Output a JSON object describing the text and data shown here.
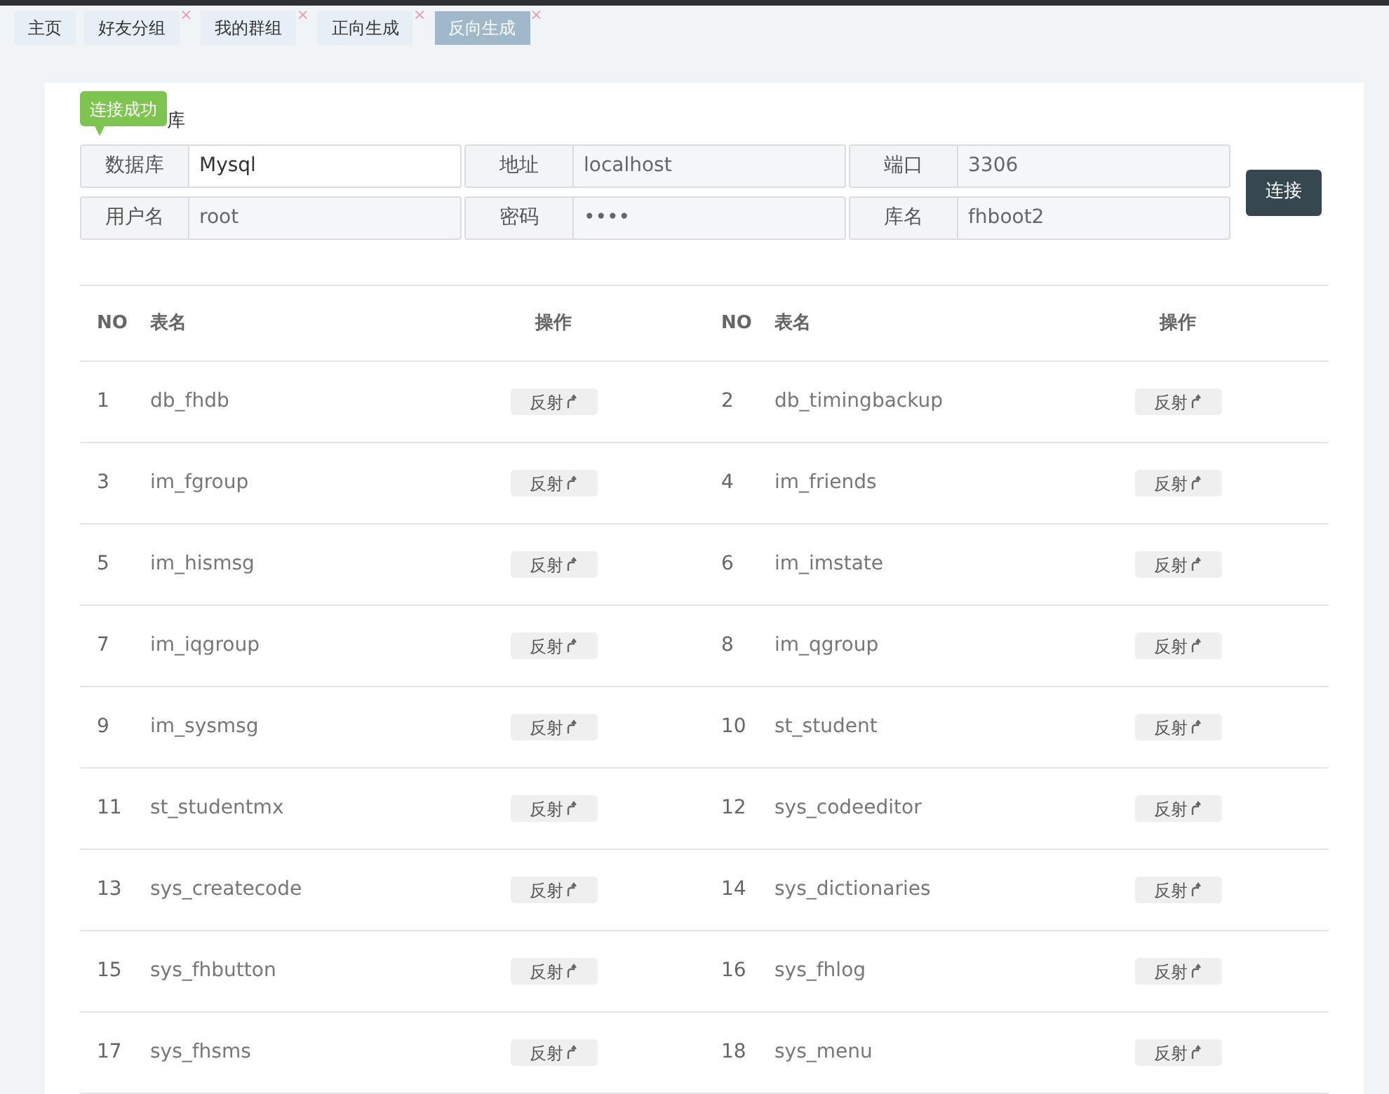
{
  "tabs": [
    {
      "label": "主页",
      "closable": false,
      "selected": false
    },
    {
      "label": "好友分组",
      "closable": true,
      "selected": false
    },
    {
      "label": "我的群组",
      "closable": true,
      "selected": false
    },
    {
      "label": "正向生成",
      "closable": true,
      "selected": false
    },
    {
      "label": "反向生成",
      "closable": true,
      "selected": true
    }
  ],
  "close_mark": "×",
  "heading": "库",
  "tooltip": "连接成功",
  "fields": [
    {
      "label": "数据库",
      "value": "Mysql",
      "disabled": false
    },
    {
      "label": "地址",
      "value": "localhost",
      "disabled": true
    },
    {
      "label": "端口",
      "value": "3306",
      "disabled": true
    },
    {
      "label": "用户名",
      "value": "root",
      "disabled": true
    },
    {
      "label": "密码",
      "value": "••••",
      "disabled": true
    },
    {
      "label": "库名",
      "value": "fhboot2",
      "disabled": true
    }
  ],
  "connect_button": "连接",
  "table": {
    "columns": [
      "NO",
      "表名",
      "操作",
      "NO",
      "表名",
      "操作"
    ],
    "rows": [
      {
        "no": "1",
        "name": "db_fhdb",
        "action": "反射"
      },
      {
        "no": "2",
        "name": "db_timingbackup",
        "action": "反射"
      },
      {
        "no": "3",
        "name": "im_fgroup",
        "action": "反射"
      },
      {
        "no": "4",
        "name": "im_friends",
        "action": "反射"
      },
      {
        "no": "5",
        "name": "im_hismsg",
        "action": "反射"
      },
      {
        "no": "6",
        "name": "im_imstate",
        "action": "反射"
      },
      {
        "no": "7",
        "name": "im_iqgroup",
        "action": "反射"
      },
      {
        "no": "8",
        "name": "im_qgroup",
        "action": "反射"
      },
      {
        "no": "9",
        "name": "im_sysmsg",
        "action": "反射"
      },
      {
        "no": "10",
        "name": "st_student",
        "action": "反射"
      },
      {
        "no": "11",
        "name": "st_studentmx",
        "action": "反射"
      },
      {
        "no": "12",
        "name": "sys_codeeditor",
        "action": "反射"
      },
      {
        "no": "13",
        "name": "sys_createcode",
        "action": "反射"
      },
      {
        "no": "14",
        "name": "sys_dictionaries",
        "action": "反射"
      },
      {
        "no": "15",
        "name": "sys_fhbutton",
        "action": "反射"
      },
      {
        "no": "16",
        "name": "sys_fhlog",
        "action": "反射"
      },
      {
        "no": "17",
        "name": "sys_fhsms",
        "action": "反射"
      },
      {
        "no": "18",
        "name": "sys_menu",
        "action": "反射"
      }
    ]
  }
}
